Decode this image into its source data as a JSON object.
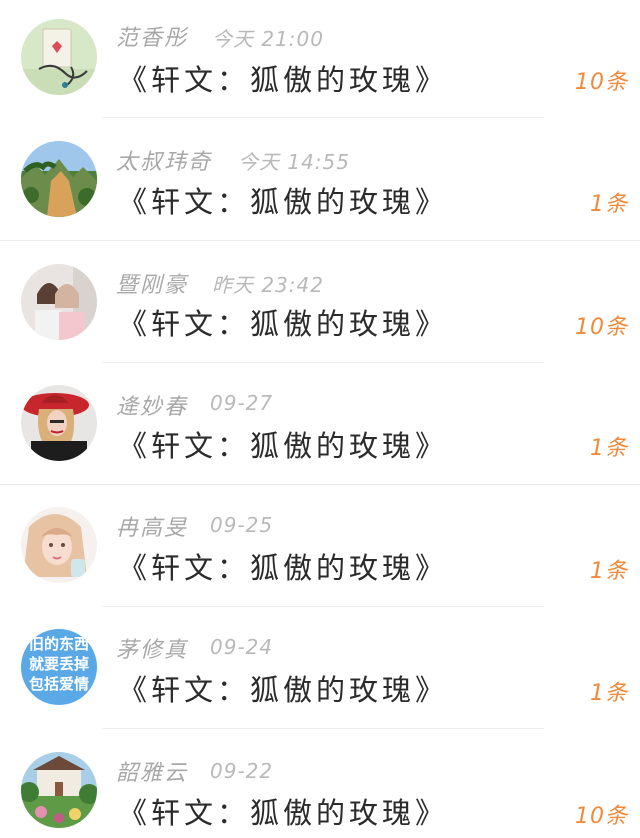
{
  "accent_color": "#f08a3a",
  "messages": [
    {
      "name": "范香彤",
      "time": "今天 21:00",
      "title": "《轩文：狐傲的玫瑰》",
      "count": "10条",
      "avatar": "ace-card-earphones-photo"
    },
    {
      "name": "太叔玮奇",
      "time": "今天 14:55",
      "title": "《轩文：狐傲的玫瑰》",
      "count": "1条",
      "avatar": "mountain-landscape-photo"
    },
    {
      "name": "暨刚豪",
      "time": "昨天 23:42",
      "title": "《轩文：狐傲的玫瑰》",
      "count": "10条",
      "avatar": "two-girls-photo"
    },
    {
      "name": "逄妙春",
      "time": "09-27",
      "title": "《轩文：狐傲的玫瑰》",
      "count": "1条",
      "avatar": "woman-red-hat-photo"
    },
    {
      "name": "冉高旻",
      "time": "09-25",
      "title": "《轩文：狐傲的玫瑰》",
      "count": "1条",
      "avatar": "blonde-girl-photo"
    },
    {
      "name": "茅修真",
      "time": "09-24",
      "title": "《轩文：狐傲的玫瑰》",
      "count": "1条",
      "avatar": "text-avatar",
      "avatar_text": [
        "旧的东西",
        "就要丢掉",
        "包括爱情"
      ]
    },
    {
      "name": "韶雅云",
      "time": "09-22",
      "title": "《轩文：狐傲的玫瑰》",
      "count": "10条",
      "avatar": "garden-house-painting"
    }
  ]
}
